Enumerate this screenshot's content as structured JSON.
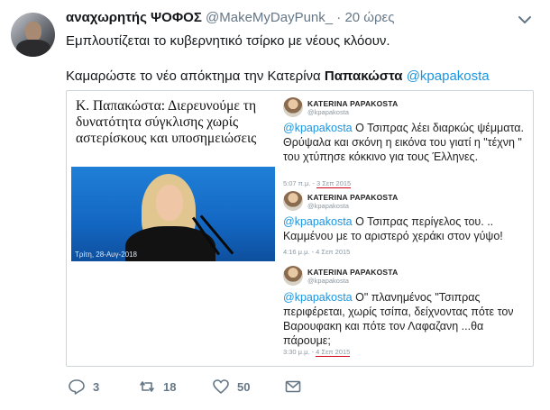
{
  "tweet": {
    "name": "αναχωρητής ΨΟΦΟΣ",
    "handle": "@MakeMyDayPunk_",
    "separator": "·",
    "time": "20 ώρες",
    "line1": "Εμπλουτίζεται το κυβερνητικό τσίρκο με νέους κλόουν.",
    "line2_prefix": "Καμαρώστε το νέο απόκτημα την Κατερίνα ",
    "line2_bold": "Παπακώστα",
    "line2_mention": "@kpapakosta"
  },
  "card": {
    "left_title": "Κ. Παπακώστα: Διερευνούμε τη δυνατότητα σύγκλισης χωρίς αστερίσκους και υποσημειώσεις",
    "photo_caption": "Τρίτη, 28-Αυγ-2018",
    "quoted": [
      {
        "name": "KATERINA PAPAKOSTA",
        "handle": "@kpapakosta",
        "mention": "@kpapakosta",
        "text": " Ο Τσιπρας λέει διαρκώς ψέμματα. Θρύψαλα και σκόνη η εικόνα του γιατί η \"τέχνη \" του χτύπησε κόκκινο για τους Έλληνες.",
        "time": "5:07 π.μ. -",
        "date": "3 Σεπ 2015"
      },
      {
        "name": "KATERINA PAPAKOSTA",
        "handle": "@kpapakosta",
        "mention": "@kpapakosta",
        "text": " Ο Τσιπρας περίγελος του. .. Καμμένου με το αριστερό χεράκι στον γύψο!",
        "time": "4:16 μ.μ. -",
        "date": "4 Σεπ 2015"
      },
      {
        "name": "KATERINA PAPAKOSTA",
        "handle": "@kpapakosta",
        "mention": "@kpapakosta",
        "text": " Ο\" πλανημένος \"Τσιπρας περιφέρεται, χωρίς τσίπα, δείχνοντας πότε τον Βαρουφακη και πότε τον Λαφαζανη ...θα πάρουμε;",
        "time": "3:30 μ.μ. -",
        "date": "4 Σεπ 2015"
      }
    ]
  },
  "actions": {
    "reply_count": "3",
    "retweet_count": "18",
    "like_count": "50"
  },
  "icons": {
    "menu": "chevron-down-icon",
    "reply": "reply-icon",
    "retweet": "retweet-icon",
    "like": "heart-icon",
    "dm": "envelope-icon"
  },
  "colors": {
    "link": "#1b95e0",
    "muted": "#657786",
    "underline": "#d0021b"
  }
}
